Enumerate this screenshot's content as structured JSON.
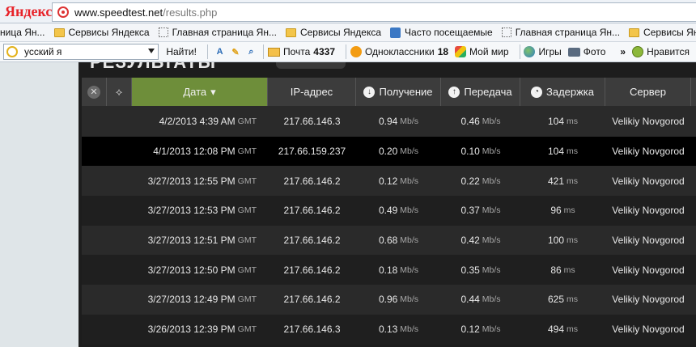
{
  "browser": {
    "logo": "Яндекс",
    "url_host": "www.speedtest.net",
    "url_path": "/results.php",
    "bookmarks": [
      {
        "label": "ница Ян...",
        "icon": "none"
      },
      {
        "label": "Сервисы Яндекса",
        "icon": "folder-icon"
      },
      {
        "label": "Главная страница Ян...",
        "icon": "page-icon"
      },
      {
        "label": "Сервисы Яндекса",
        "icon": "folder-icon"
      },
      {
        "label": "Часто посещаемые",
        "icon": "magnifier-icon"
      },
      {
        "label": "Главная страница Ян...",
        "icon": "page-icon"
      },
      {
        "label": "Сервисы Яндекса",
        "icon": "folder-icon"
      }
    ],
    "toolbar": {
      "search_value": "усский я",
      "find_label": "Найти!",
      "mail_label": "Почта",
      "mail_count": "4337",
      "ok_label": "Одноклассники",
      "ok_count": "18",
      "moimir_label": "Мой мир",
      "games_label": "Игры",
      "photo_label": "Фото",
      "more_label": "»",
      "like_label": "Нравится"
    }
  },
  "page": {
    "heading": "РЕЗУЛЬТАТЫ"
  },
  "table": {
    "headers": {
      "date": "Дата",
      "date_sort": "▾",
      "ip": "IP-адрес",
      "download": "Получение",
      "upload": "Передача",
      "latency": "Задержка",
      "server": "Сервер"
    },
    "rows": [
      {
        "date": "4/2/2013 4:39 AM",
        "tz": "GMT",
        "ip": "217.66.146.3",
        "down": "0.94",
        "up": "0.46",
        "ping": "104",
        "server": "Velikiy Novgorod"
      },
      {
        "date": "4/1/2013 12:08 PM",
        "tz": "GMT",
        "ip": "217.66.159.237",
        "down": "0.20",
        "up": "0.10",
        "ping": "104",
        "server": "Velikiy Novgorod"
      },
      {
        "date": "3/27/2013 12:55 PM",
        "tz": "GMT",
        "ip": "217.66.146.2",
        "down": "0.12",
        "up": "0.22",
        "ping": "421",
        "server": "Velikiy Novgorod"
      },
      {
        "date": "3/27/2013 12:53 PM",
        "tz": "GMT",
        "ip": "217.66.146.2",
        "down": "0.49",
        "up": "0.37",
        "ping": "96",
        "server": "Velikiy Novgorod"
      },
      {
        "date": "3/27/2013 12:51 PM",
        "tz": "GMT",
        "ip": "217.66.146.2",
        "down": "0.68",
        "up": "0.42",
        "ping": "100",
        "server": "Velikiy Novgorod"
      },
      {
        "date": "3/27/2013 12:50 PM",
        "tz": "GMT",
        "ip": "217.66.146.2",
        "down": "0.18",
        "up": "0.35",
        "ping": "86",
        "server": "Velikiy Novgorod"
      },
      {
        "date": "3/27/2013 12:49 PM",
        "tz": "GMT",
        "ip": "217.66.146.2",
        "down": "0.96",
        "up": "0.44",
        "ping": "625",
        "server": "Velikiy Novgorod"
      },
      {
        "date": "3/26/2013 12:39 PM",
        "tz": "GMT",
        "ip": "217.66.146.3",
        "down": "0.13",
        "up": "0.12",
        "ping": "494",
        "server": "Velikiy Novgorod"
      }
    ],
    "speed_unit": "Mb/s",
    "latency_unit": "ms"
  }
}
